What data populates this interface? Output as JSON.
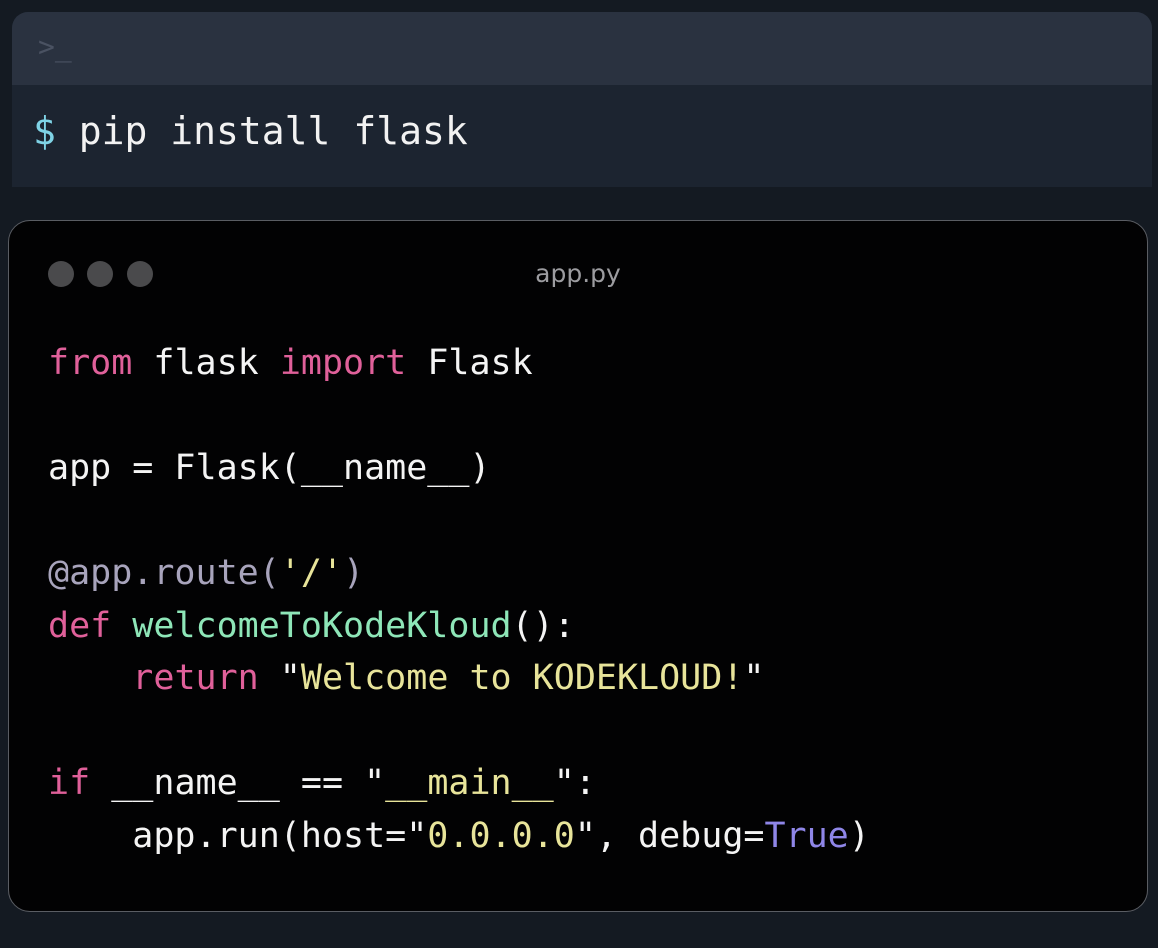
{
  "terminal": {
    "prompt_icon": ">_",
    "prompt_symbol": "$",
    "command": "pip install flask"
  },
  "editor": {
    "filename": "app.py",
    "window_controls": [
      "close-dot",
      "minimize-dot",
      "maximize-dot"
    ],
    "lines": [
      [
        {
          "t": "from",
          "c": "kw"
        },
        {
          "t": " flask ",
          "c": "plain"
        },
        {
          "t": "import",
          "c": "kw"
        },
        {
          "t": " Flask",
          "c": "plain"
        }
      ],
      [],
      [
        {
          "t": "app = Flask(__name__)",
          "c": "plain"
        }
      ],
      [],
      [
        {
          "t": "@app.route(",
          "c": "dec"
        },
        {
          "t": "'/'",
          "c": "str"
        },
        {
          "t": ")",
          "c": "dec"
        }
      ],
      [
        {
          "t": "def ",
          "c": "kw"
        },
        {
          "t": "welcomeToKodeKloud",
          "c": "fn"
        },
        {
          "t": "():",
          "c": "plain"
        }
      ],
      [
        {
          "t": "    ",
          "c": "plain"
        },
        {
          "t": "return",
          "c": "kw"
        },
        {
          "t": " \"",
          "c": "plain"
        },
        {
          "t": "Welcome to KODEKLOUD!",
          "c": "str"
        },
        {
          "t": "\"",
          "c": "plain"
        }
      ],
      [],
      [
        {
          "t": "if",
          "c": "kw"
        },
        {
          "t": " __name__ == \"",
          "c": "plain"
        },
        {
          "t": "__main__",
          "c": "str"
        },
        {
          "t": "\":",
          "c": "plain"
        }
      ],
      [
        {
          "t": "    app.run(host=\"",
          "c": "plain"
        },
        {
          "t": "0.0.0.0",
          "c": "str"
        },
        {
          "t": "\", debug=",
          "c": "plain"
        },
        {
          "t": "True",
          "c": "bool"
        },
        {
          "t": ")",
          "c": "plain"
        }
      ]
    ]
  },
  "colors": {
    "keyword": "#e0609a",
    "function": "#8ee6b8",
    "string": "#e8e49a",
    "decorator": "#a8a4bc",
    "boolean": "#8f86e8",
    "prompt": "#7fd3e6"
  }
}
